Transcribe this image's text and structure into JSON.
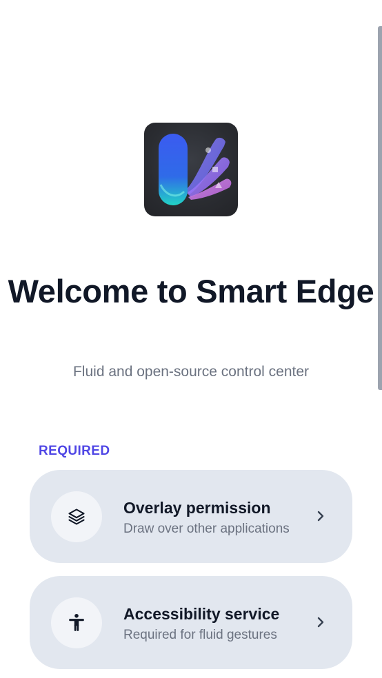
{
  "welcome": {
    "title": "Welcome to Smart Edge",
    "subtitle": "Fluid and open-source control center"
  },
  "required": {
    "section_label": "REQUIRED",
    "items": [
      {
        "title": "Overlay permission",
        "description": "Draw over other applications",
        "icon": "layers-icon"
      },
      {
        "title": "Accessibility service",
        "description": "Required for fluid gestures",
        "icon": "accessibility-icon"
      }
    ]
  },
  "colors": {
    "accent": "#4f46e5",
    "card_background": "#e2e7ef",
    "title_text": "#111827",
    "secondary_text": "#6b7280"
  }
}
